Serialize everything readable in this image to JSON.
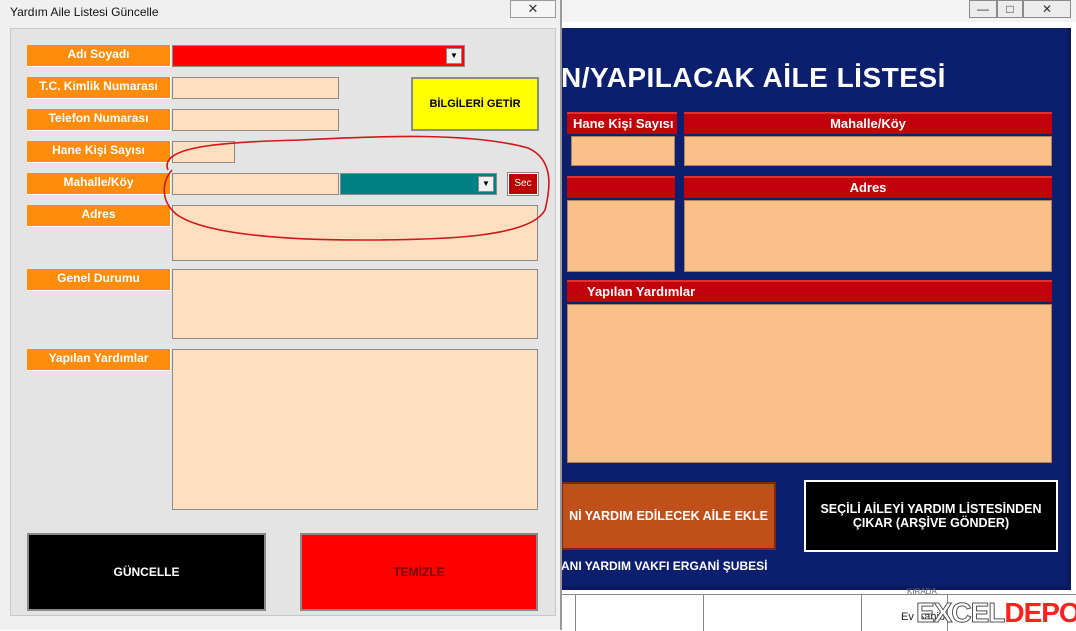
{
  "background_window": {
    "title": "N/YAPILACAK AİLE LİSTESİ",
    "headers": {
      "hane": "Hane Kişi Sayısı",
      "mahalle": "Mahalle/Köy",
      "adres": "Adres",
      "yapilan": "Yapılan Yardımlar"
    },
    "add_button": "Nİ YARDIM EDİLECEK AİLE EKLE",
    "remove_button_line1": "SEÇİLİ AİLEYİ YARDIM LİSTESİNDEN",
    "remove_button_line2": "ÇIKAR (ARŞİVE GÖNDER)",
    "footer": "ANI YARDIM VAKFI ERGANİ ŞUBESİ",
    "sheet_cells": [
      "KIRADA",
      "Ev Sahibi"
    ],
    "watermark_a": "EXCEL",
    "watermark_b": "DEPO",
    "win_buttons": [
      "—",
      "□",
      "✕"
    ]
  },
  "dialog": {
    "title": "Yardım Aile Listesi Güncelle",
    "close": "✕",
    "labels": {
      "adi": "Adı Soyadı",
      "tc": "T.C. Kimlik Numarası",
      "telefon": "Telefon Numarası",
      "hane": "Hane Kişi Sayısı",
      "mahalle": "Mahalle/Köy",
      "adres": "Adres",
      "genel": "Genel Durumu",
      "yapilan": "Yapılan Yardımlar"
    },
    "values": {
      "adi": "",
      "tc": "",
      "telefon": "",
      "hane": "",
      "mahalle": "",
      "mahalle_select": "",
      "adres": "",
      "genel": "",
      "yapilan": ""
    },
    "bilgileri_getir": "BİLGİLERİ GETİR",
    "sec": "Sec",
    "guncelle": "GÜNCELLE",
    "temizle": "TEMİZLE"
  },
  "colors": {
    "label_orange": "#ff8c0a",
    "field_peach": "#ffdfc0",
    "name_combo_red": "#ff0000",
    "mahalle_combo_teal": "#008080",
    "getir_yellow": "#ffff00",
    "guncelle_black": "#000000",
    "temizle_red": "#ff0000",
    "form_navy": "#0c1f6e",
    "annotation_red": "#d01818"
  }
}
